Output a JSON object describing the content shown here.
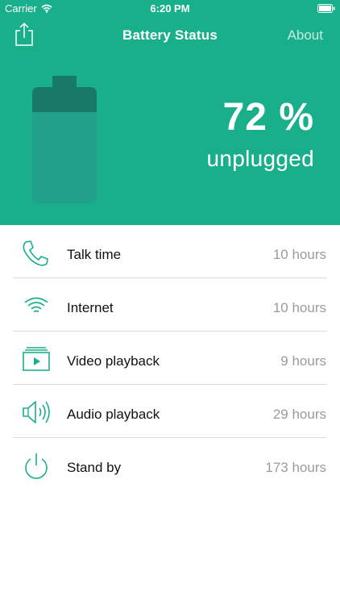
{
  "status_bar": {
    "carrier": "Carrier",
    "time": "6:20 PM"
  },
  "nav": {
    "title": "Battery Status",
    "about_label": "About"
  },
  "battery": {
    "percent_text": "72 %",
    "level": 0.72,
    "state": "unplugged"
  },
  "colors": {
    "header_bg": "#1aaf8b",
    "battery_body": "#23a08a",
    "battery_cap": "#187a66",
    "icon": "#1aaf8b",
    "value_text": "#9b9b9b"
  },
  "usage": [
    {
      "icon": "phone-icon",
      "label": "Talk time",
      "value": "10 hours"
    },
    {
      "icon": "wifi-icon",
      "label": "Internet",
      "value": "10 hours"
    },
    {
      "icon": "video-icon",
      "label": "Video playback",
      "value": "9 hours"
    },
    {
      "icon": "speaker-icon",
      "label": "Audio playback",
      "value": "29 hours"
    },
    {
      "icon": "power-icon",
      "label": "Stand by",
      "value": "173 hours"
    }
  ]
}
